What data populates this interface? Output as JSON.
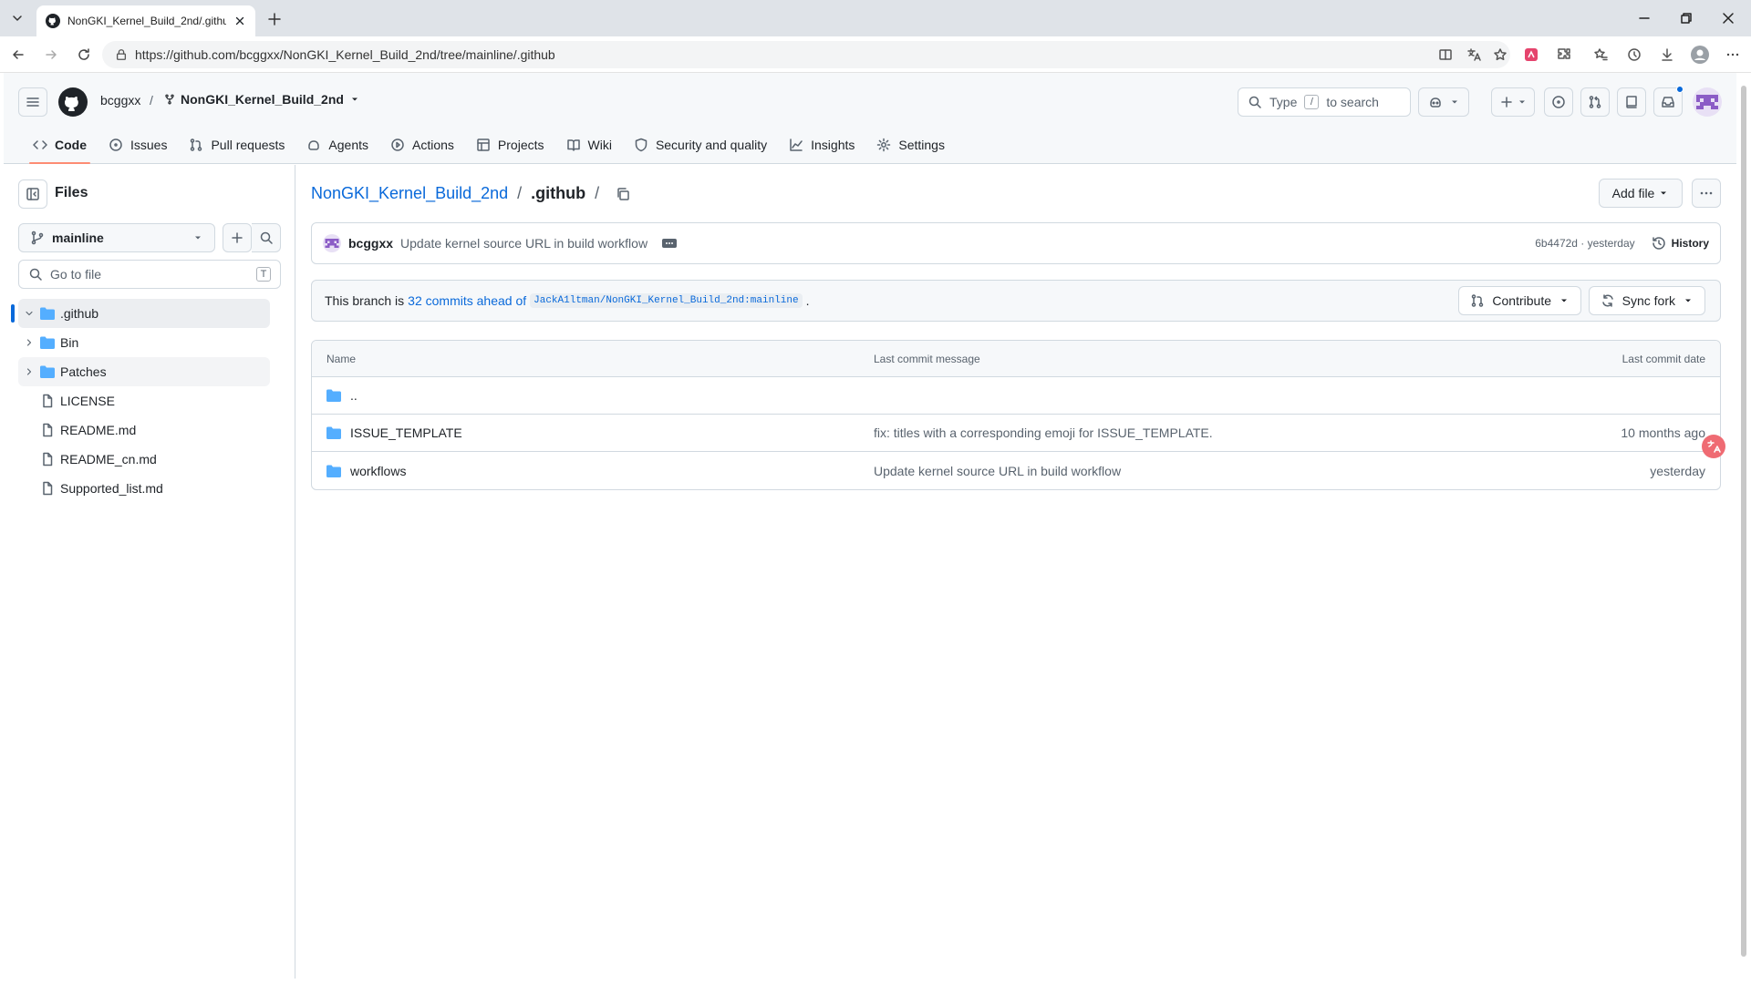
{
  "browser": {
    "tab_title": "NonGKI_Kernel_Build_2nd/.github",
    "url": "https://github.com/bcggxx/NonGKI_Kernel_Build_2nd/tree/mainline/.github"
  },
  "header": {
    "owner": "bcggxx",
    "separator": "/",
    "repo": "NonGKI_Kernel_Build_2nd",
    "search_prefix": "Type",
    "search_key": "/",
    "search_suffix": "to search"
  },
  "repo_nav": [
    {
      "label": "Code",
      "icon": "code-icon",
      "active": true
    },
    {
      "label": "Issues",
      "icon": "issue-icon"
    },
    {
      "label": "Pull requests",
      "icon": "pull-request-icon"
    },
    {
      "label": "Agents",
      "icon": "agents-icon"
    },
    {
      "label": "Actions",
      "icon": "play-icon"
    },
    {
      "label": "Projects",
      "icon": "table-icon"
    },
    {
      "label": "Wiki",
      "icon": "book-icon"
    },
    {
      "label": "Security and quality",
      "icon": "shield-icon"
    },
    {
      "label": "Insights",
      "icon": "graph-icon"
    },
    {
      "label": "Settings",
      "icon": "gear-icon"
    }
  ],
  "sidebar": {
    "title": "Files",
    "branch": "mainline",
    "goto_placeholder": "Go to file",
    "goto_key": "T",
    "tree": [
      {
        "label": ".github",
        "type": "folder",
        "expanded": true,
        "selected": true
      },
      {
        "label": "Bin",
        "type": "folder"
      },
      {
        "label": "Patches",
        "type": "folder",
        "hover": true
      },
      {
        "label": "LICENSE",
        "type": "file"
      },
      {
        "label": "README.md",
        "type": "file"
      },
      {
        "label": "README_cn.md",
        "type": "file"
      },
      {
        "label": "Supported_list.md",
        "type": "file"
      }
    ]
  },
  "main": {
    "breadcrumb_repo": "NonGKI_Kernel_Build_2nd",
    "breadcrumb_sep": "/",
    "breadcrumb_current": ".github",
    "breadcrumb_trail": "/",
    "add_file_label": "Add file",
    "commit": {
      "author": "bcggxx",
      "message": "Update kernel source URL in build workflow",
      "meta": "6b4472d · yesterday",
      "history_label": "History"
    },
    "branch_status": {
      "prefix": "This branch is",
      "ahead_link": "32 commits ahead of",
      "upstream": "JackA1ltman/NonGKI_Kernel_Build_2nd:mainline",
      "suffix": "."
    },
    "contribute_label": "Contribute",
    "sync_fork_label": "Sync fork",
    "table": {
      "columns": [
        "Name",
        "Last commit message",
        "Last commit date"
      ],
      "rows": [
        {
          "name": "..",
          "message": "",
          "date": ""
        },
        {
          "name": "ISSUE_TEMPLATE",
          "message": "fix: titles with a corresponding emoji for ISSUE_TEMPLATE.",
          "date": "10 months ago"
        },
        {
          "name": "workflows",
          "message": "Update kernel source URL in build workflow",
          "date": "yesterday"
        }
      ]
    }
  },
  "colors": {
    "link": "#0969da",
    "folder": "#54aeff",
    "active_tab_underline": "#fd8c73",
    "selected_indicator": "#0969da"
  }
}
